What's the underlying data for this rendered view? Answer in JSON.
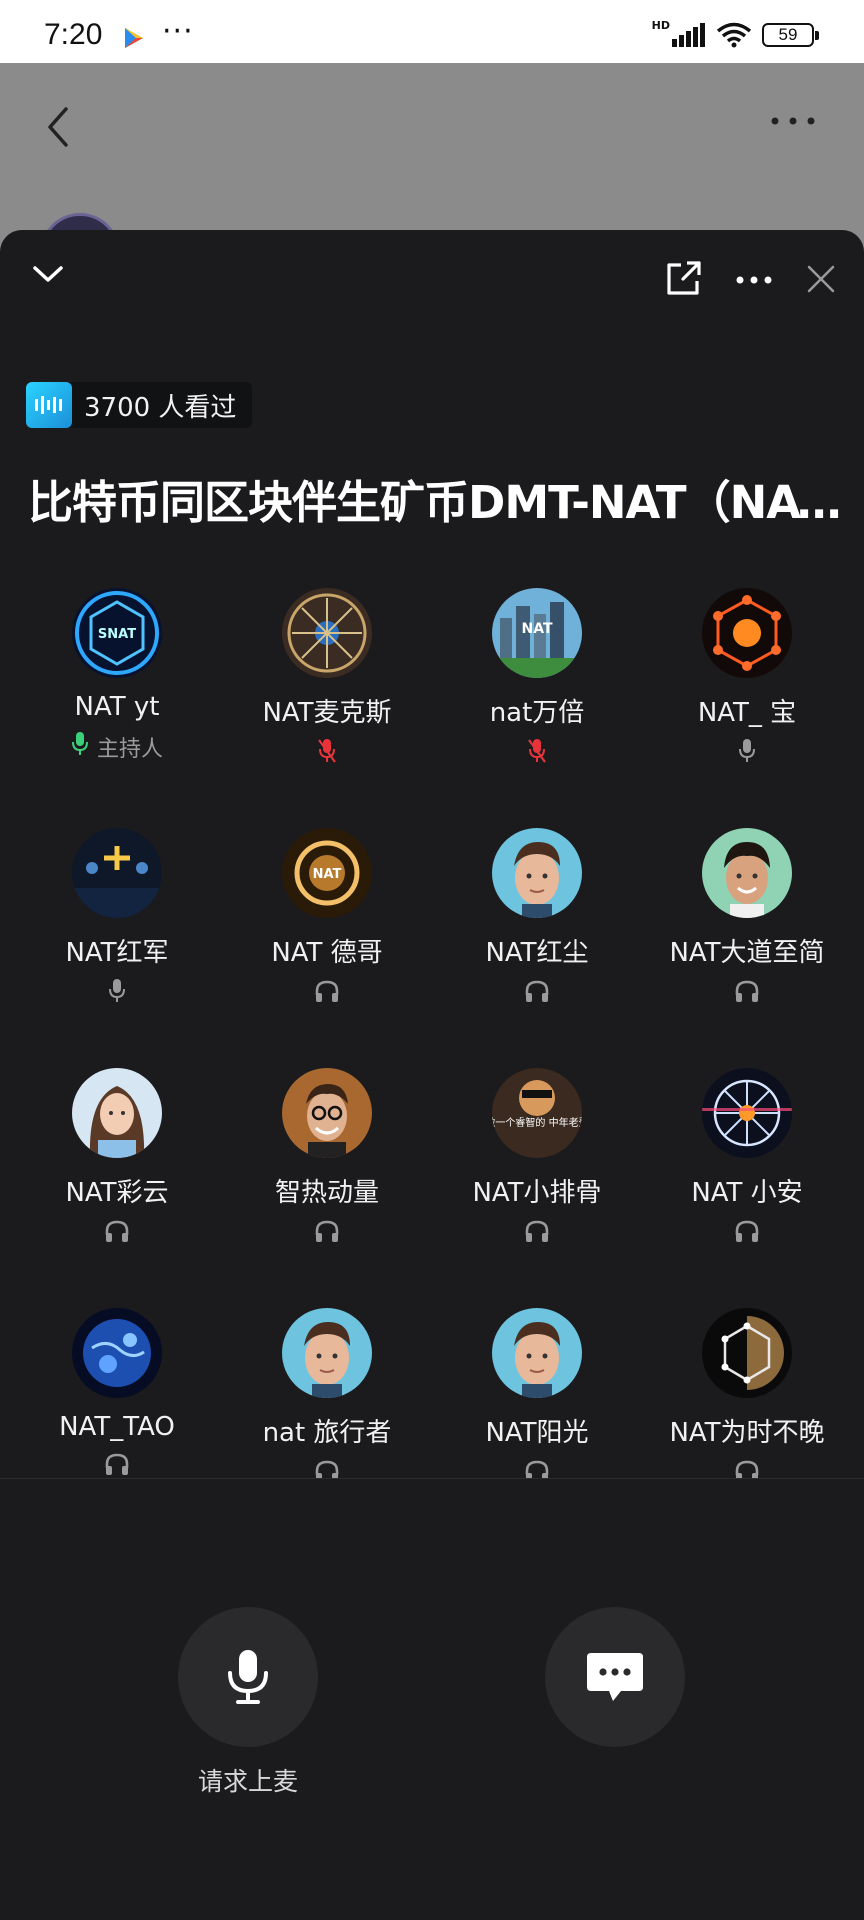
{
  "status_bar": {
    "time": "7:20",
    "network": "HD",
    "battery": "59"
  },
  "sheet": {
    "viewers_text": "3700 人看过",
    "title": "比特币同区块伴生矿币DMT-NAT（NAT…"
  },
  "members": [
    {
      "name": "NAT yt",
      "role": "主持人",
      "status": "mic-on"
    },
    {
      "name": "NAT麦克斯",
      "status": "mic-muted"
    },
    {
      "name": "nat万倍",
      "status": "mic-muted"
    },
    {
      "name": "NAT_ 宝",
      "status": "mic-idle"
    },
    {
      "name": "NAT红军",
      "status": "mic-idle"
    },
    {
      "name": "NAT 德哥",
      "status": "listener"
    },
    {
      "name": "NAT红尘",
      "status": "listener"
    },
    {
      "name": "NAT大道至简",
      "status": "listener"
    },
    {
      "name": "NAT彩云",
      "status": "listener"
    },
    {
      "name": "智热动量",
      "status": "listener"
    },
    {
      "name": "NAT小排骨",
      "status": "listener"
    },
    {
      "name": "NAT 小安",
      "status": "listener"
    },
    {
      "name": "NAT_TAO",
      "status": "listener"
    },
    {
      "name": "nat 旅行者",
      "status": "listener"
    },
    {
      "name": "NAT阳光",
      "status": "listener"
    },
    {
      "name": "NAT为时不晚",
      "status": "listener"
    }
  ],
  "avatar_labels": {
    "hex_logo": "SNAT",
    "city": "NAT",
    "gold": "NAT",
    "poster_caption": "做一个睿智的 中年老登"
  },
  "actions": {
    "raise_hand_label": "请求上麦"
  },
  "colors": {
    "sheet_bg": "#1b1b1d",
    "muted_red": "#e8333a",
    "active_green": "#3bd17a",
    "accent_blue": "#2ad3ff"
  }
}
